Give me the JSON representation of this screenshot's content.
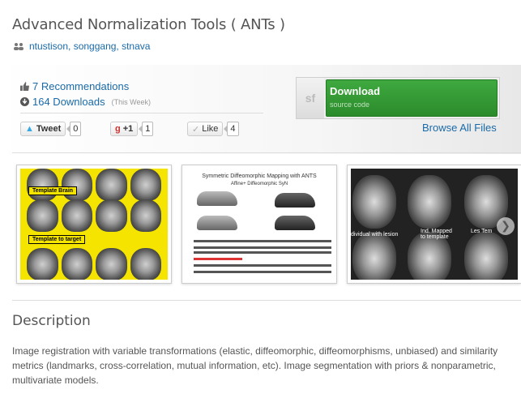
{
  "project": {
    "title": "Advanced Normalization Tools ( ANTs )",
    "authors": "ntustison, songgang, stnava"
  },
  "stats": {
    "recommendations": "7 Recommendations",
    "downloads": "164 Downloads",
    "period": "(This Week)"
  },
  "share": {
    "tweet_label": "Tweet",
    "tweet_count": "0",
    "gplus_label": "+1",
    "gplus_count": "1",
    "like_label": "Like",
    "like_count": "4"
  },
  "download": {
    "logo": "sf",
    "label": "Download",
    "sublabel": "source code",
    "browse": "Browse All Files"
  },
  "screenshots": [
    {
      "labels": [
        "Template Brain",
        "Template to target"
      ]
    },
    {
      "heading": "Symmetric Diffeomorphic Mapping with ANTS",
      "subheading": "Affine+ Diffeomorphic SyN"
    },
    {
      "captions": [
        "dividual with lesion",
        "Ind. Mapped to template",
        "Les Tem"
      ]
    }
  ],
  "description": {
    "heading": "Description",
    "body": "Image registration with variable transformations (elastic, diffeomorphic, diffeomorphisms, unbiased) and similarity metrics (landmarks, cross-correlation, mutual information, etc). Image segmentation with priors & nonparametric, multivariate models."
  },
  "colors": {
    "link": "#1a6aa8",
    "download_green": "#3fa93f"
  }
}
